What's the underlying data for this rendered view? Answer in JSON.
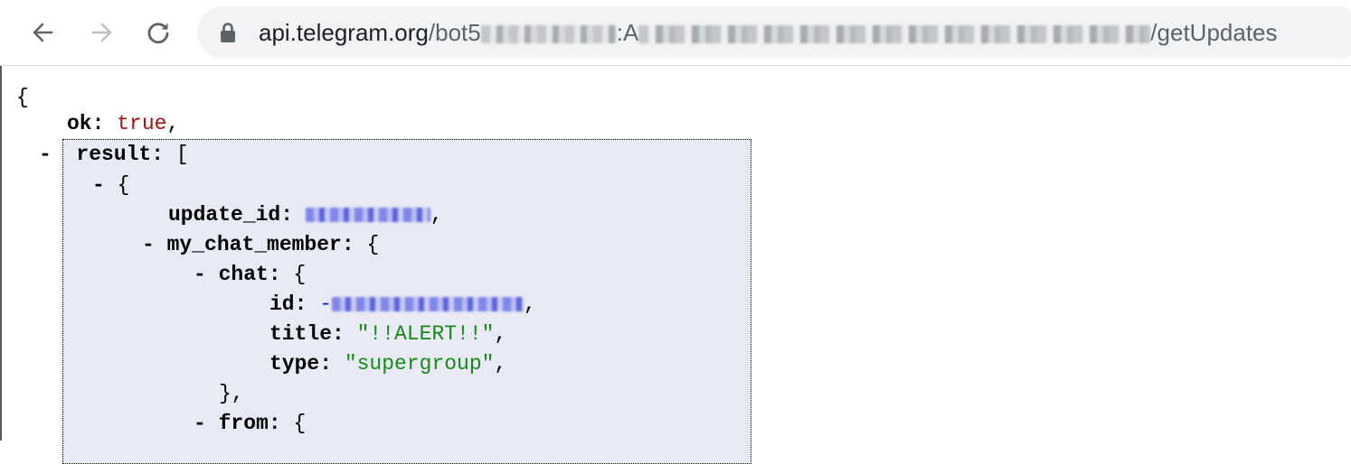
{
  "browser": {
    "url": {
      "host": "api.telegram.org",
      "path_prefix": "/bot5",
      "path_middle": ":A",
      "path_suffix": "/getUpdates"
    },
    "icons": [
      "back-arrow-icon",
      "forward-arrow-icon",
      "reload-icon",
      "lock-icon"
    ]
  },
  "json_viewer": {
    "open_brace": "{",
    "ok_key": "ok",
    "ok_value": "true",
    "result_key": "result",
    "open_bracket": "[",
    "collapse_symbol": "-",
    "open_brace_item": "{",
    "update_id_key": "update_id",
    "my_chat_member_key": "my_chat_member",
    "chat_key": "chat",
    "id_key": "id",
    "id_prefix": "-",
    "title_key": "title",
    "title_value": "\"!!ALERT!!\"",
    "type_key": "type",
    "type_value": "\"supergroup\"",
    "close_chat": "},",
    "from_key": "from",
    "colors": {
      "key": "#000000",
      "boolean": "#a31515",
      "string": "#178a17",
      "number": "#1b1bd0",
      "highlight": "#e8eaf6"
    }
  }
}
